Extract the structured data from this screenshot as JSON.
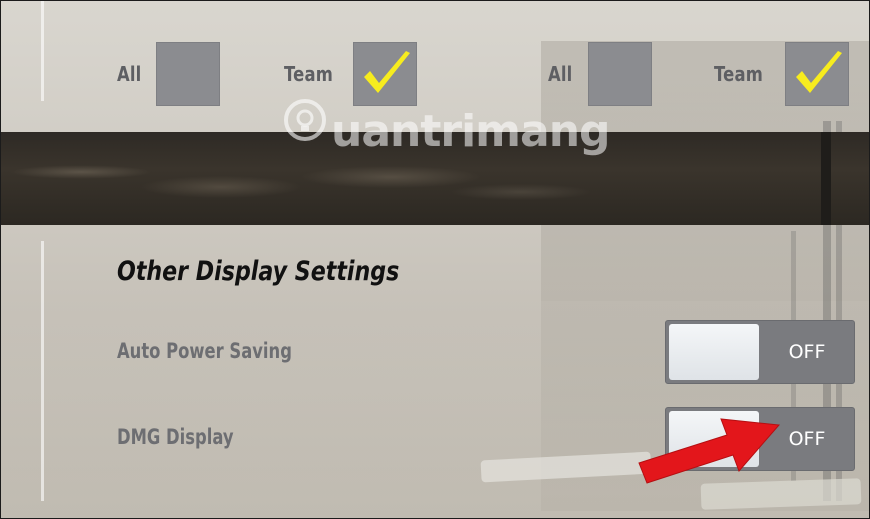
{
  "filters": {
    "left": {
      "all_label": "All",
      "all_checked": false,
      "team_label": "Team",
      "team_checked": true
    },
    "right": {
      "all_label": "All",
      "all_checked": false,
      "team_label": "Team",
      "team_checked": true
    }
  },
  "watermark": {
    "text": "uantrimang"
  },
  "other_display": {
    "title": "Other Display Settings",
    "settings": [
      {
        "label": "Auto Power Saving",
        "state": "OFF"
      },
      {
        "label": "DMG Display",
        "state": "OFF"
      }
    ]
  },
  "colors": {
    "checkbox_bg": "#8b8c90",
    "checkmark": "#f7ec1e",
    "toggle_bg": "#7a7b7f",
    "arrow": "#e3161b",
    "dark_band": "#2e2a25"
  },
  "icons": {
    "checkmark": "checkmark-icon",
    "watermark_logo": "lightbulb-icon",
    "arrow": "arrow-annotation"
  }
}
